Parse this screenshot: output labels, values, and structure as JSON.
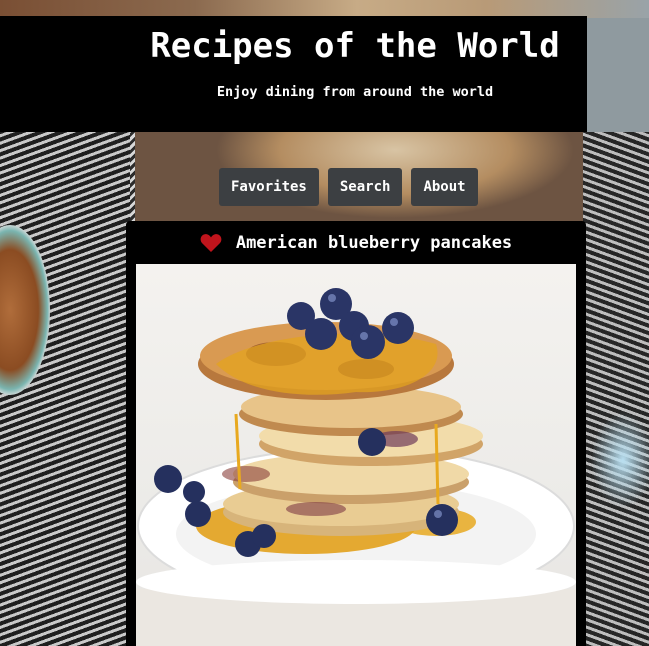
{
  "header": {
    "title": "Recipes of the World",
    "subtitle": "Enjoy dining from around the world"
  },
  "nav": {
    "items": [
      {
        "label": "Favorites"
      },
      {
        "label": "Search"
      },
      {
        "label": "About"
      }
    ]
  },
  "recipe": {
    "title": "American blueberry pancakes",
    "favorite_icon": "heart-icon",
    "heart_color": "#c0141c",
    "image_subject": "stack of pancakes with blueberries and syrup"
  },
  "colors": {
    "header_bg": "#000000",
    "nav_button_bg": "#3c3f42",
    "card_bg": "#000000",
    "text": "#ffffff"
  }
}
